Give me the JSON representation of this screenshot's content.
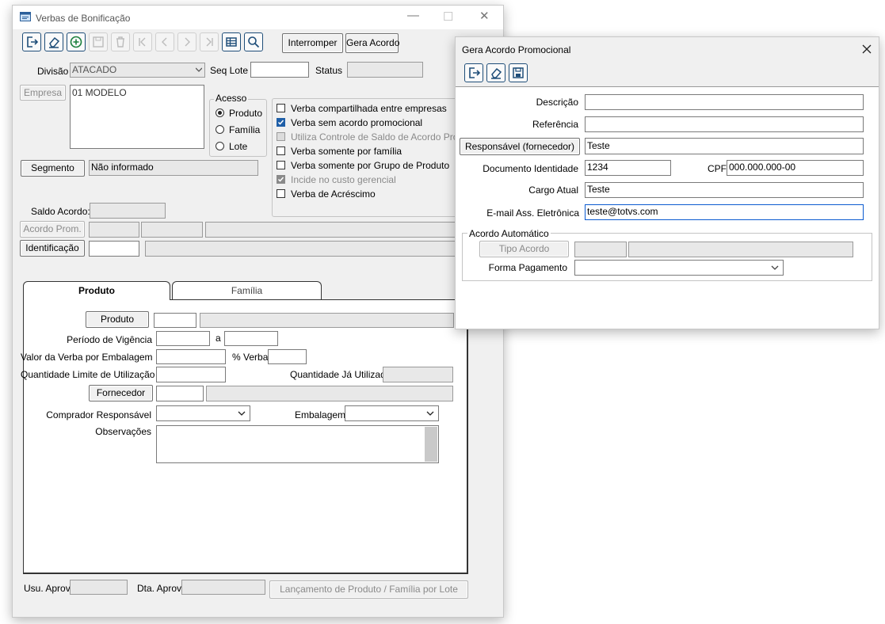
{
  "main": {
    "title": "Verbas de Bonificação",
    "buttons": {
      "interromper": "Interromper",
      "gera_acordo": "Gera Acordo"
    },
    "labels": {
      "divisao": "Divisão",
      "seq_lote": "Seq Lote",
      "status": "Status",
      "empresa": "Empresa",
      "acesso": "Acesso",
      "segmento": "Segmento",
      "saldo_acordo": "Saldo Acordo:",
      "acordo_prom": "Acordo Prom.",
      "identificacao": "Identificação"
    },
    "values": {
      "divisao": "ATACADO",
      "empresa": "01 MODELO",
      "segmento": "Não informado"
    },
    "radios": [
      {
        "label": "Produto",
        "selected": true
      },
      {
        "label": "Família",
        "selected": false
      },
      {
        "label": "Lote",
        "selected": false
      }
    ],
    "checkboxes": [
      {
        "label": "Verba compartilhada entre empresas",
        "checked": false,
        "enabled": true
      },
      {
        "label": "Verba sem acordo promocional",
        "checked": true,
        "enabled": true
      },
      {
        "label": "Utiliza Controle de Saldo de Acordo Prom.",
        "checked": false,
        "enabled": false
      },
      {
        "label": "Verba somente por família",
        "checked": false,
        "enabled": true
      },
      {
        "label": "Verba somente por Grupo de Produto",
        "checked": false,
        "enabled": true
      },
      {
        "label": "Incide no custo gerencial",
        "checked": true,
        "enabled": false
      },
      {
        "label": "Verba de Acréscimo",
        "checked": false,
        "enabled": true
      }
    ],
    "tabs": [
      {
        "label": "Produto",
        "active": true
      },
      {
        "label": "Família",
        "active": false
      }
    ],
    "produto_tab": {
      "produto_btn": "Produto",
      "periodo": "Período de Vigência",
      "periodo_a": "a",
      "valor_verba": "Valor da Verba por Embalagem",
      "pct_verba": "% Verba",
      "qtd_limite": "Quantidade Limite de Utilização",
      "qtd_utilizada": "Quantidade Já Utilizada",
      "fornecedor_btn": "Fornecedor",
      "comprador": "Comprador Responsável",
      "embalagem": "Embalagem",
      "observacoes": "Observações"
    },
    "footer": {
      "usu_aprov": "Usu. Aprov.",
      "dta_aprov": "Dta. Aprov.",
      "lancamento_btn": "Lançamento de Produto / Família por Lote"
    }
  },
  "dialog": {
    "title": "Gera Acordo Promocional",
    "labels": {
      "descricao": "Descrição",
      "referencia": "Referência",
      "responsavel_btn": "Responsável (fornecedor)",
      "documento": "Documento Identidade",
      "cpf": "CPF",
      "cargo": "Cargo Atual",
      "email": "E-mail Ass. Eletrônica",
      "acordo_auto": "Acordo Automático",
      "tipo_acordo_btn": "Tipo Acordo",
      "forma_pagamento": "Forma Pagamento"
    },
    "values": {
      "descricao": "",
      "referencia": "",
      "responsavel": "Teste",
      "documento": "1234",
      "cpf": "000.000.000-00",
      "cargo": "Teste",
      "email": "teste@totvs.com"
    }
  },
  "colors": {
    "toolbar_border": "#1f4e79",
    "add_icon": "#1a7f3c",
    "check_blue": "#1f5fa8",
    "focus": "#0b5bd0"
  }
}
